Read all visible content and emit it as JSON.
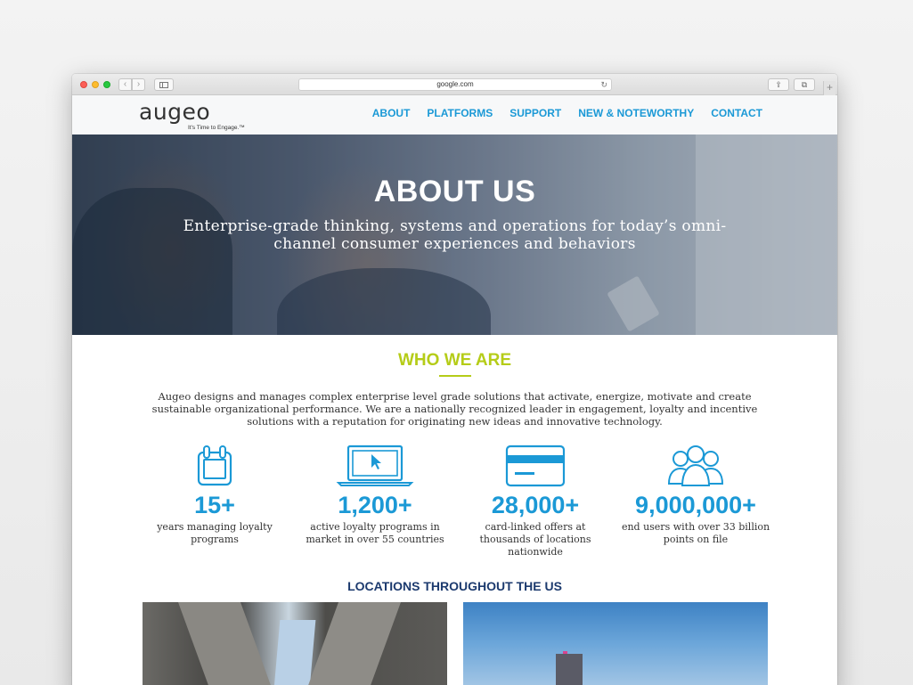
{
  "browser": {
    "url": "google.com",
    "back_glyph": "‹",
    "forward_glyph": "›",
    "reload_glyph": "↻",
    "share_glyph": "⇪",
    "tabs_glyph": "⧉",
    "newtab_glyph": "+"
  },
  "site": {
    "logo_word": "augeo",
    "logo_tagline": "It's Time to Engage.™",
    "nav": [
      "ABOUT",
      "PLATFORMS",
      "SUPPORT",
      "NEW & NOTEWORTHY",
      "CONTACT"
    ]
  },
  "hero": {
    "title": "ABOUT US",
    "subtitle": "Enterprise-grade thinking, systems and operations for today’s omni-channel consumer experiences and behaviors"
  },
  "who_we_are": {
    "title": "WHO WE ARE",
    "intro": "Augeo designs and manages complex enterprise level grade solutions that activate, energize, motivate and create sustainable organizational performance. We are a nationally recognized leader in engagement, loyalty and incentive solutions with a reputation for originating new ideas and innovative technology.",
    "stats": [
      {
        "icon": "calendar-icon",
        "value": "15+",
        "label": "years managing loyalty programs"
      },
      {
        "icon": "laptop-cursor-icon",
        "value": "1,200+",
        "label": "active loyalty programs in market in over 55 countries"
      },
      {
        "icon": "credit-card-icon",
        "value": "28,000+",
        "label": "card-linked offers at thousands of locations nationwide"
      },
      {
        "icon": "users-group-icon",
        "value": "9,000,000+",
        "label": "end users with over 33 billion points on file"
      }
    ]
  },
  "locations": {
    "title": "LOCATIONS THROUGHOUT THE US"
  },
  "colors": {
    "nav_blue": "#1b99d6",
    "accent_green": "#b5cc18",
    "navy": "#1c3a6e"
  }
}
